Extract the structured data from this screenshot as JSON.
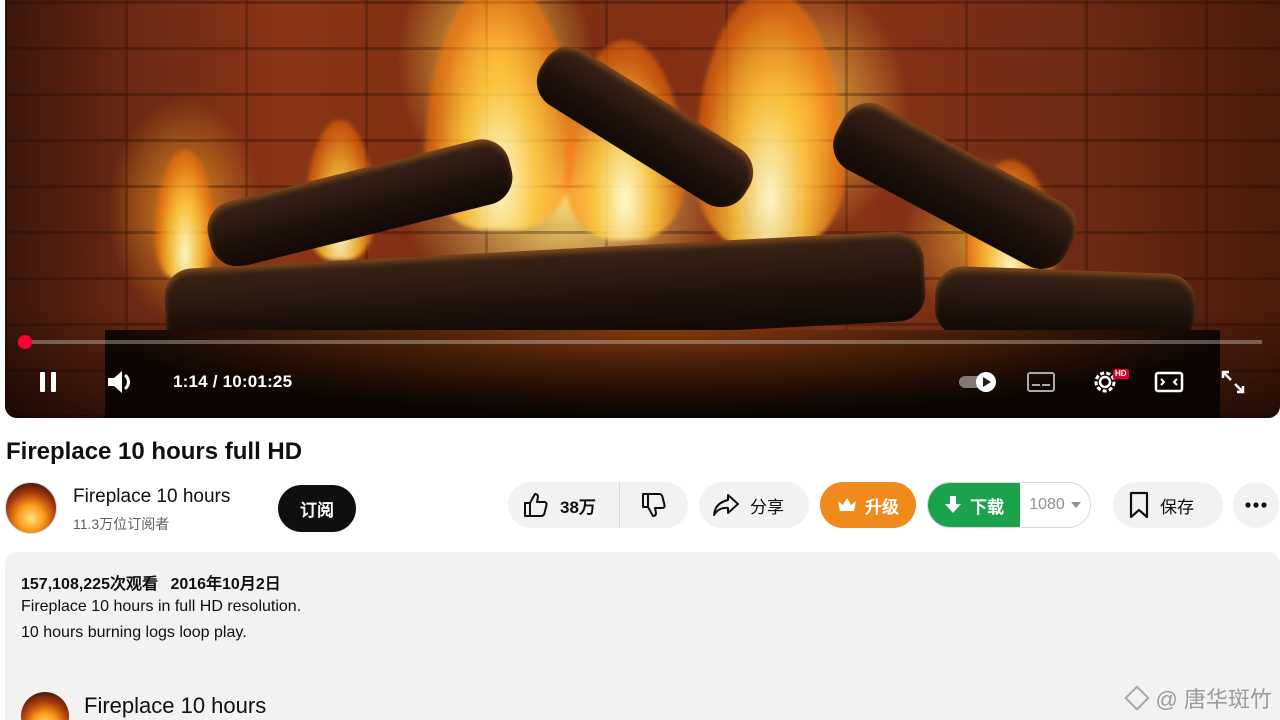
{
  "player": {
    "current_time": "1:14",
    "duration": "10:01:25",
    "time_display": "1:14 / 10:01:25",
    "progress_fraction": 0.002,
    "hd_badge": "HD",
    "accent_color": "#ff0000"
  },
  "video": {
    "title": "Fireplace 10 hours full HD"
  },
  "channel": {
    "name": "Fireplace 10 hours",
    "subscribers": "11.3万位订阅者",
    "subscribe_label": "订阅"
  },
  "actions": {
    "like_count": "38万",
    "share_label": "分享",
    "upgrade_label": "升级",
    "download_label": "下载",
    "quality_value": "1080",
    "save_label": "保存"
  },
  "description": {
    "views": "157,108,225次观看",
    "date": "2016年10月2日",
    "line1": "Fireplace 10 hours in full HD resolution.",
    "line2": "10 hours burning logs loop play.",
    "channel_name": "Fireplace 10 hours"
  },
  "watermark": {
    "text": "@ 唐华斑竹"
  },
  "icons": {
    "pause": "pause-icon",
    "volume": "volume-icon",
    "autoplay": "autoplay-toggle-icon",
    "captions": "captions-icon",
    "settings": "settings-gear-icon",
    "theater": "theater-mode-icon",
    "fullscreen": "fullscreen-icon",
    "like": "thumbs-up-icon",
    "dislike": "thumbs-down-icon",
    "share": "share-arrow-icon",
    "upgrade": "crown-icon",
    "download": "download-arrow-icon",
    "save": "bookmark-icon",
    "more": "more-dots-icon"
  },
  "colors": {
    "upgrade": "#f08a1c",
    "download": "#1aa34a",
    "subscribe": "#0f0f0f"
  }
}
